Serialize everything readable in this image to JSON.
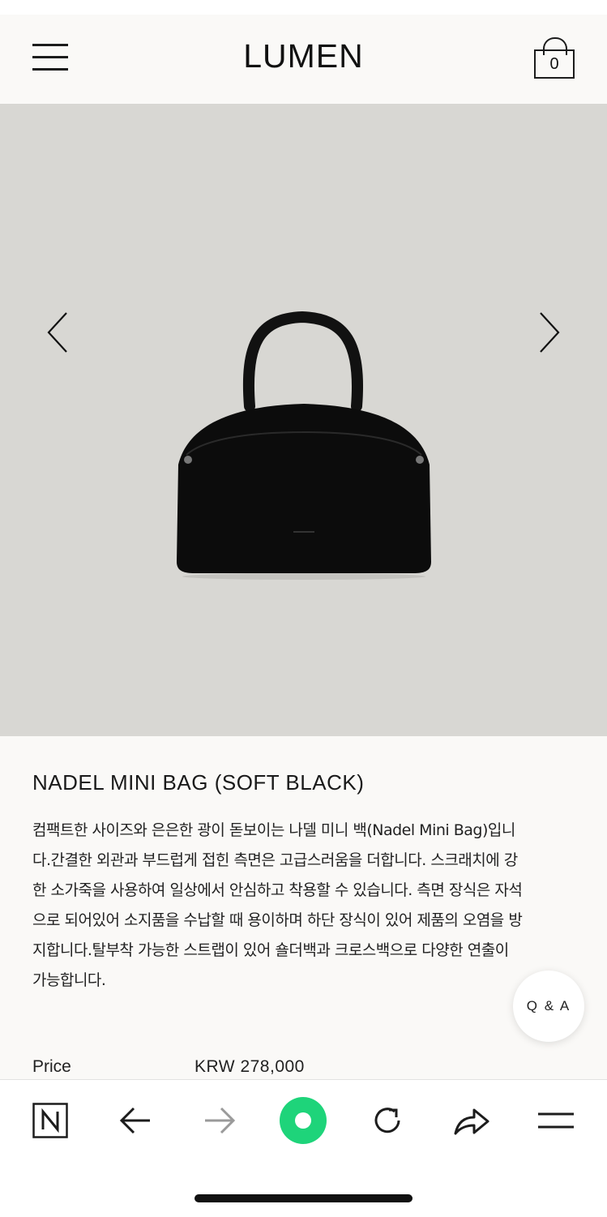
{
  "header": {
    "logo": "LUMEN",
    "cart_count": "0"
  },
  "product": {
    "title": "NADEL MINI BAG (SOFT BLACK)",
    "description_lines": [
      "컴팩트한 사이즈와 은은한 광이 돋보이는 나델 미니 백(Nadel Mini Bag)입니",
      "다.간결한 외관과 부드럽게 접힌 측면은 고급스러움을 더합니다. 스크래치에 강",
      "한 소가죽을 사용하여 일상에서 안심하고 착용할 수 있습니다. 측면 장식은 자석",
      "으로 되어있어 소지품을 수납할 때 용이하며 하단 장식이 있어 제품의 오염을 방",
      "지합니다.탈부착 가능한 스트랩이 있어 숄더백과 크로스백으로 다양한 연출이",
      "가능합니다."
    ],
    "price_label": "Price",
    "price_value": "KRW 278,000"
  },
  "qa_button": "Q & A",
  "toolbar": {
    "icons": [
      "naver-n-icon",
      "back-arrow-icon",
      "forward-arrow-icon",
      "green-dot-icon",
      "reload-icon",
      "share-icon",
      "menu-icon"
    ]
  },
  "colors": {
    "hero_bg": "#d8d7d3",
    "accent_green": "#1ed47a"
  }
}
